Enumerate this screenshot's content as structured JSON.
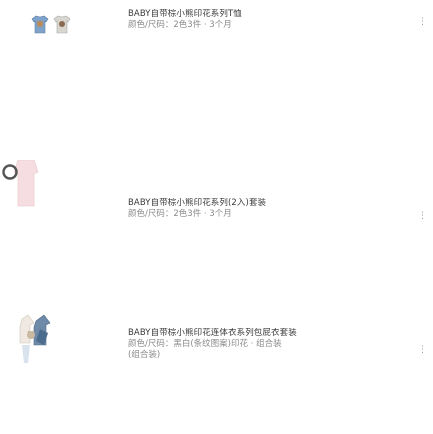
{
  "items": [
    {
      "title": "BABY自带棕小熊印花系列T恤",
      "spec": "颜色/尺码：2色3件 · 3个月",
      "more_icon": "⋮",
      "image": "bear-tee-thumbnail"
    },
    {
      "title": "BABY自带棕小熊印花系列(2入)套装",
      "spec": "颜色/尺码：2色3件 · 3个月",
      "more_icon": "⋮",
      "image": "pink-bodysuit-thumbnail"
    },
    {
      "title": "BABY自带棕小熊印花连体衣系列包屁衣套装",
      "spec": "颜色/尺码：黑白(条纹图案)印花 · 组合装",
      "spec_extra": "(组合装)",
      "more_icon": "⋮",
      "image": "bear-romper-thumbnail"
    }
  ],
  "colors": {
    "title": "#3a3a3a",
    "spec": "#8a8a8a",
    "icon": "#9a9a9a"
  }
}
